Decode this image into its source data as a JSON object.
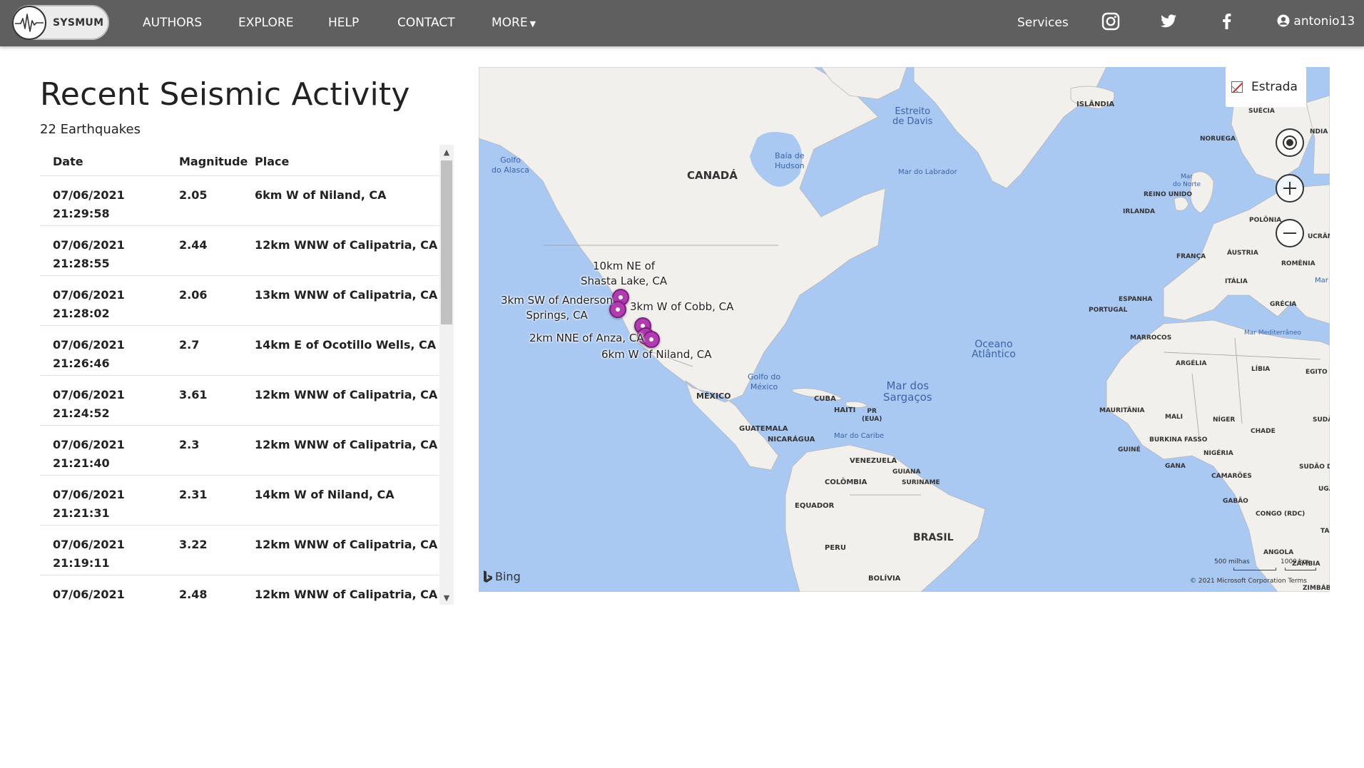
{
  "navbar": {
    "brand": "SYSMUM",
    "links": [
      "AUTHORS",
      "EXPLORE",
      "HELP",
      "CONTACT",
      "MORE"
    ],
    "services": "Services",
    "user": "antonio13",
    "icons": [
      "instagram-icon",
      "twitter-icon",
      "facebook-icon",
      "user-circle-icon"
    ]
  },
  "main": {
    "title": "Recent Seismic Activity",
    "count": "22 Earthquakes"
  },
  "table": {
    "headers": {
      "date": "Date",
      "magnitude": "Magnitude",
      "place": "Place"
    },
    "rows": [
      {
        "date": "07/06/2021",
        "time": "21:29:58",
        "magnitude": "2.05",
        "place": "6km W of Niland, CA"
      },
      {
        "date": "07/06/2021",
        "time": "21:28:55",
        "magnitude": "2.44",
        "place": "12km WNW of Calipatria, CA"
      },
      {
        "date": "07/06/2021",
        "time": "21:28:02",
        "magnitude": "2.06",
        "place": "13km WNW of Calipatria, CA"
      },
      {
        "date": "07/06/2021",
        "time": "21:26:46",
        "magnitude": "2.7",
        "place": "14km E of Ocotillo Wells, CA"
      },
      {
        "date": "07/06/2021",
        "time": "21:24:52",
        "magnitude": "3.61",
        "place": "12km WNW of Calipatria, CA"
      },
      {
        "date": "07/06/2021",
        "time": "21:21:40",
        "magnitude": "2.3",
        "place": "12km WNW of Calipatria, CA"
      },
      {
        "date": "07/06/2021",
        "time": "21:21:31",
        "magnitude": "2.31",
        "place": "14km W of Niland, CA"
      },
      {
        "date": "07/06/2021",
        "time": "21:19:11",
        "magnitude": "3.22",
        "place": "12km WNW of Calipatria, CA"
      },
      {
        "date": "07/06/2021",
        "time": "",
        "magnitude": "2.48",
        "place": "12km WNW of Calipatria, CA"
      }
    ]
  },
  "map": {
    "style_button": "Estrada",
    "attribution_logo": "Bing",
    "copyright": "© 2021 Microsoft Corporation  Terms",
    "scale_miles": "500 milhas",
    "scale_km": "1000 km",
    "pin_labels": {
      "shasta": "10km NE of\nShasta Lake, CA",
      "anderson": "3km SW of Anderson\nSprings, CA",
      "cobb": "3km W of Cobb, CA",
      "anza": "2km NNE of Anza, CA",
      "niland": "6km W of Niland, CA"
    },
    "countries": {
      "canada": "CANADÁ",
      "mexico": "MÉXICO",
      "cuba": "CUBA",
      "haiti": "HAITI",
      "pr": "PR\n(EUA)",
      "guatemala": "GUATEMALA",
      "nicaragua": "NICARÁGUA",
      "venezuela": "VENEZUELA",
      "guiana": "GUIANA",
      "suriname": "SURINAME",
      "colombia": "COLÔMBIA",
      "equador": "EQUADOR",
      "peru": "PERU",
      "brasil": "BRASIL",
      "bolivia": "BOLÍVIA",
      "islandia": "ISLÂNDIA",
      "suecia": "SUÉCIA",
      "finlandia": "NDIA",
      "noruega": "NORUEGA",
      "reino_unido": "REINO UNIDO",
      "irlanda": "IRLANDA",
      "polonia": "POLÔNIA",
      "ucrania": "UCRÂN",
      "franca": "FRANÇA",
      "austria": "ÁUSTRIA",
      "romenia": "ROMÊNIA",
      "italia": "ITÁLIA",
      "espanha": "ESPANHA",
      "portugal": "PORTUGAL",
      "grecia": "GRÉCIA",
      "marrocos": "MARROCOS",
      "argelia": "ARGÉLIA",
      "libia": "LÍBIA",
      "egito": "EGITO",
      "mauritania": "MAURITÂNIA",
      "mali": "MALI",
      "niger": "NÍGER",
      "chade": "CHADE",
      "sudao": "SUDÃ",
      "burkina": "BURKINA FASSO",
      "guine": "GUINÉ",
      "nigeria": "NIGÉRIA",
      "gana": "GANA",
      "camaroes": "CAMARÕES",
      "sudao_sul": "SUDÃO DO S",
      "uganda": "UGA",
      "gabao": "GABÃO",
      "congo": "CONGO (RDC)",
      "angola": "ANGOLA",
      "zambia": "ZÂMBIA",
      "zimbabue": "ZIMBÁBU",
      "ta": "TA"
    },
    "waters": {
      "golfo_alasca": "Golfo\ndo Alasca",
      "baia_hudson": "Baía de\nHudson",
      "estreito_davis": "Estreito\nde Davis",
      "mar_labrador": "Mar do Labrador",
      "mar_norte": "Mar\ndo Norte",
      "oceano_atlantico": "Oceano\nAtlântico",
      "mar_sargacos": "Mar dos\nSargaços",
      "golfo_mexico": "Golfo do\nMéxico",
      "mar_caribe": "Mar do Caribe",
      "mar_mediterraneo": "Mar Mediterrâneo",
      "mar": "Mar"
    }
  },
  "colors": {
    "navbar_bg": "#5f5f5f",
    "ocean": "#a9c8f2",
    "land": "#f2f0ec",
    "pin": "#b13bb0"
  }
}
